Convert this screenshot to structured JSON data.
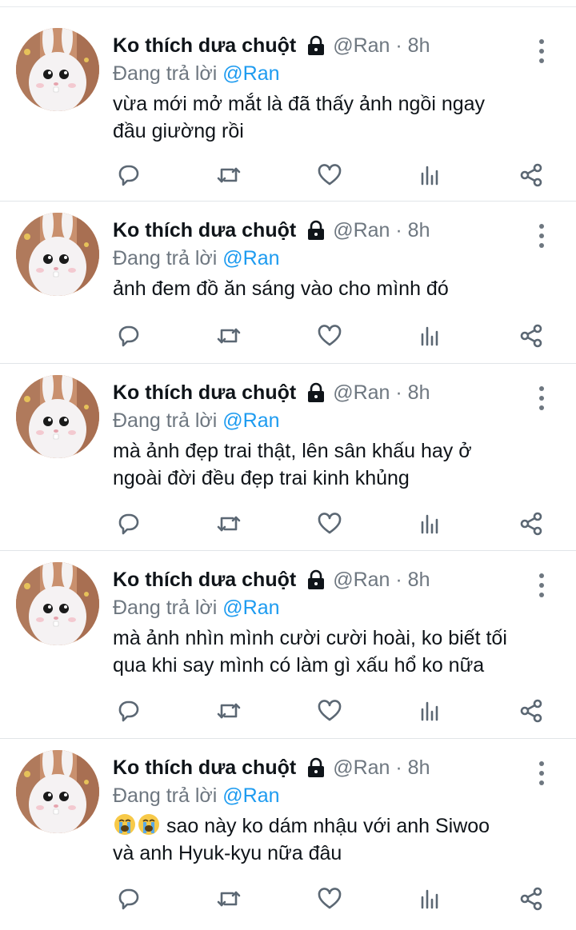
{
  "tweets": [
    {
      "name": "Ko thích dưa chuột",
      "handle_time": "@Ran · 8h",
      "reply_prefix": "Đang trả lời ",
      "reply_mention": "@Ran",
      "text_lines": [
        "vừa mới mở mắt là đã thấy ảnh ngồi ngay",
        "đầu giường rồi"
      ],
      "emoji": ""
    },
    {
      "name": "Ko thích dưa chuột",
      "handle_time": "@Ran · 8h",
      "reply_prefix": "Đang trả lời ",
      "reply_mention": "@Ran",
      "text_lines": [
        "ảnh đem đồ ăn sáng vào cho mình đó"
      ],
      "emoji": ""
    },
    {
      "name": "Ko thích dưa chuột",
      "handle_time": "@Ran · 8h",
      "reply_prefix": "Đang trả lời ",
      "reply_mention": "@Ran",
      "text_lines": [
        "mà ảnh đẹp trai thật, lên sân khấu hay ở",
        "ngoài đời đều đẹp trai kinh khủng"
      ],
      "emoji": ""
    },
    {
      "name": "Ko thích dưa chuột",
      "handle_time": "@Ran · 8h",
      "reply_prefix": "Đang trả lời ",
      "reply_mention": "@Ran",
      "text_lines": [
        "mà ảnh nhìn mình cười cười hoài, ko biết tối",
        "qua khi say mình có làm gì xấu hổ ko nữa"
      ],
      "emoji": ""
    },
    {
      "name": "Ko thích dưa chuột",
      "handle_time": "@Ran · 8h",
      "reply_prefix": "Đang trả lời ",
      "reply_mention": "@Ran",
      "text_lines": [
        " sao này ko dám nhậu với anh Siwoo",
        "và anh Hyuk-kyu nữa đâu"
      ],
      "emoji": "loudly-crying-face-icon x2"
    }
  ],
  "icons": {
    "lock": "lock-icon",
    "more": "more-vertical-icon",
    "reply": "reply-icon",
    "retweet": "retweet-icon",
    "like": "heart-icon",
    "views": "analytics-icon",
    "share": "share-icon"
  },
  "colors": {
    "mention": "#1d9bf0",
    "secondary_text": "#6e7780",
    "icon": "#5b6773"
  }
}
